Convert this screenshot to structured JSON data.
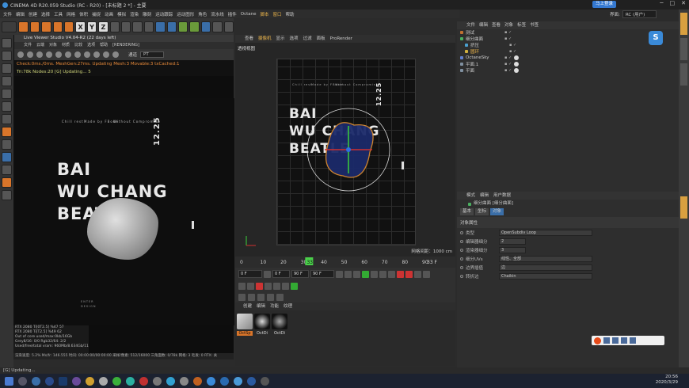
{
  "window_title": "CINEMA 4D R20.059 Studio (RC - R20) - [未标题 2 *] - 主要",
  "login_button": "马上登录",
  "layout_label": "界面:",
  "layout_value": "RC (用户)",
  "menu": [
    "文件",
    "编辑",
    "创建",
    "选择",
    "工具",
    "网格",
    "体积",
    "捕捉",
    "动画",
    "模拟",
    "渲染",
    "雕刻",
    "运动跟踪",
    "运动图形",
    "角色",
    "流水线",
    "插件",
    "Octane",
    "脚本",
    "窗口",
    "帮助"
  ],
  "toolbar_labels": {
    "x": "X",
    "y": "Y",
    "z": "Z"
  },
  "live_viewer": {
    "title": "Live Viewer Studio V4.04-R2 (22 days left)",
    "menu": [
      "文件",
      "云端",
      "对象",
      "材质",
      "比较",
      "选项",
      "帮助",
      "[RENDERING]"
    ],
    "channel_label": "通道",
    "channel_value": "PT",
    "status_line1": "Check:0ms./0ms. MeshGen:27ms. Updating Mesh:3 Movable:3 txCached:1",
    "status_line2": "Tri:78k Nodes:20 [G] Updating...  5",
    "gpu": [
      "RTX 2080 Ti[0T2.5]   %47   57",
      "RTX 2080 Ti[T2.5]    %49   62",
      "Out of core used/max:0kb/16Gb",
      "Grey8/16: 0/0      Rgb32/64: 2/2",
      "Used/free/total vram: 960Mb/8.634Gb/11"
    ],
    "bottom": "渲染速度: 5.2%   Ms/fr: 146.555   时间: 00:00:00/00:00:00   采样/像素: 512/16000   三角面数: 0/78k   网格: 3   毛发: 0   RTX: 关"
  },
  "poster": {
    "line1": "BAI",
    "line2": "WU CHANG",
    "line3": "BEATLE",
    "date": "12.25",
    "small1": "Chill rest",
    "small2": "Made by FBone",
    "small3": "Without Compromise",
    "tags": [
      "ENTER",
      "DESIGN"
    ]
  },
  "viewport": {
    "tabs": [
      "查看",
      "摄像机",
      "显示",
      "选项",
      "过滤",
      "面板",
      "ProRender"
    ],
    "label": "透视视图",
    "grid_info": "网格间距：1000 cm"
  },
  "timeline": {
    "ticks": [
      "0",
      "10",
      "20",
      "30",
      "33",
      "40",
      "50",
      "60",
      "70",
      "80",
      "90"
    ],
    "current": "33 F"
  },
  "controls": {
    "start": "0 F",
    "end": "90 F",
    "start2": "0 F",
    "end2": "90 F"
  },
  "materials": {
    "tabs": [
      "创建",
      "编辑",
      "功能",
      "纹理"
    ],
    "items": [
      "OctSp",
      "OctDi",
      "OctDi"
    ]
  },
  "objects": {
    "tabs": [
      "文件",
      "编辑",
      "查看",
      "对象",
      "标签",
      "书签"
    ],
    "rows": [
      {
        "name": "测试",
        "color": "#c07030"
      },
      {
        "name": "细分曲面",
        "color": "#4ab060"
      },
      {
        "name": "挤压",
        "color": "#4aa0d0"
      },
      {
        "name": "圆环",
        "color": "#d0b040"
      },
      {
        "name": "OctaneSky",
        "color": "#6080d0"
      },
      {
        "name": "平面.1",
        "color": "#8090a0"
      },
      {
        "name": "平面",
        "color": "#8090a0"
      }
    ]
  },
  "attributes": {
    "tabs": [
      "模式",
      "编辑",
      "用户数据"
    ],
    "object_title": "细分曲面 [细分曲面]",
    "subtabs": [
      "基本",
      "坐标",
      "对象"
    ],
    "section": "对象属性",
    "rows": [
      {
        "label": "类型",
        "value": "OpenSubdiv Loop"
      },
      {
        "label": "编辑器细分",
        "value": "2"
      },
      {
        "label": "渲染器细分",
        "value": "3"
      },
      {
        "label": "细分UVs",
        "value": "线性、全部"
      },
      {
        "label": "边界插值",
        "value": "边"
      },
      {
        "label": "转折边",
        "value": "Chaikin"
      }
    ]
  },
  "status_text": "[G] Updating...",
  "clock": {
    "time": "20:56",
    "date": "2020/3/29"
  }
}
